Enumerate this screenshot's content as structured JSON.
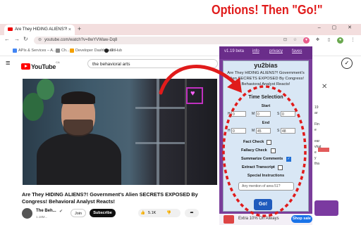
{
  "annotation": {
    "title": "Options! Then \"Go!\""
  },
  "browser": {
    "tab_title": "Are They HIDING ALIENS?!",
    "tab_close": "×",
    "new_tab": "+",
    "window_controls": "– ▢ ✕",
    "url": "youtube.com/watch?v=8wYVWaw-Dq8",
    "bookmarks": [
      {
        "label": "APIs & Services – A...",
        "icon_color": "#4285f4"
      },
      {
        "label": "Ch...",
        "icon_color": "#888888"
      },
      {
        "label": "Developer Dashboard",
        "icon_color": "#f4a000"
      },
      {
        "label": "GitHub",
        "icon_color": "#222222"
      }
    ]
  },
  "youtube": {
    "logo_text": "YouTube",
    "logo_country": "CA",
    "search_value": "the behavioral arts",
    "video_title": "Are They HIDING ALIENS?! Government's Alien SECRETS EXPOSED By Congress! Behavioral Analyst Reacts!",
    "channel_name": "The Beh...",
    "subscriber_count": "1.18M...",
    "join_label": "Join",
    "subscribe_label": "Subscribe",
    "like_count": "5.1K",
    "share_icon": "share-icon",
    "side_texts": [
      "19",
      "ar",
      "Fin",
      "e",
      "ear",
      "vhat",
      "e",
      "y",
      "tha"
    ]
  },
  "popup": {
    "version": "v1.19 beta",
    "links": [
      "info",
      "privacy",
      "faves"
    ],
    "app_name": "yu2bias",
    "video_title": "Are They HIDING ALIENS?! Government's Alien SECRETS EXPOSED By Congress! Behavioral Analyst Reacts!",
    "section_title": "Time Selection",
    "start_label": "Start",
    "end_label": "End",
    "start": {
      "h": "0",
      "m": "0",
      "s": "0",
      "h_label": "H",
      "m_label": "M",
      "s_label": "S"
    },
    "end": {
      "h": "0",
      "m": "45",
      "s": "48",
      "h_label": "H",
      "m_label": "M",
      "s_label": "S"
    },
    "options": [
      {
        "label": "Fact Check",
        "checked": false
      },
      {
        "label": "Fallacy Check",
        "checked": false
      },
      {
        "label": "Summarize Comments",
        "checked": true
      },
      {
        "label": "Extract Transcript",
        "checked": false
      }
    ],
    "special_label": "Special Instructions",
    "special_placeholder": "Any mention of area 51?",
    "go_label": "Go!",
    "ad_text": "Extra 10% Off Always",
    "ad_button": "Shop sale"
  }
}
